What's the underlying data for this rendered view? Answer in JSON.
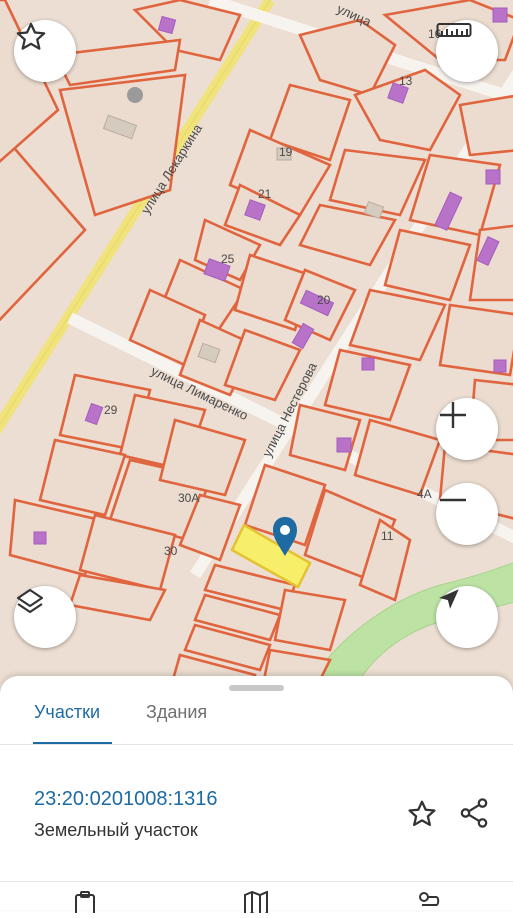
{
  "map": {
    "streets": [
      {
        "id": "lekarkina",
        "label": "улица Лекаркина"
      },
      {
        "id": "limarenko",
        "label": "улица Лимаренко"
      },
      {
        "id": "nesterova",
        "label": "улица Нестерова"
      },
      {
        "id": "top",
        "label": "улица"
      }
    ],
    "house_numbers": [
      "16",
      "13",
      "19",
      "21",
      "25",
      "20",
      "29",
      "30А",
      "30",
      "11",
      "4А"
    ],
    "colors": {
      "parcel_fill": "#ebdccf",
      "parcel_stroke": "#e0643e",
      "building": "#b873c9",
      "selected_parcel": "#f7ef6a",
      "marker": "#1e6aa3",
      "main_road": "#f0e37c",
      "green_area": "#bde3a4"
    },
    "controls": {
      "favorite": "star-icon",
      "ruler": "ruler-icon",
      "layers": "layers-icon",
      "zoom_in": "plus-icon",
      "zoom_out": "minus-icon",
      "locate": "navigation-arrow-icon"
    }
  },
  "sheet": {
    "tabs": [
      {
        "label": "Участки",
        "active": true
      },
      {
        "label": "Здания",
        "active": false
      }
    ],
    "result": {
      "cadastral_number": "23:20:0201008:1316",
      "object_type": "Земельный участок"
    },
    "actions": [
      "star-icon",
      "share-icon"
    ],
    "bottom_nav_icons": [
      "clipboard-icon",
      "map-icon",
      "route-icon"
    ]
  }
}
